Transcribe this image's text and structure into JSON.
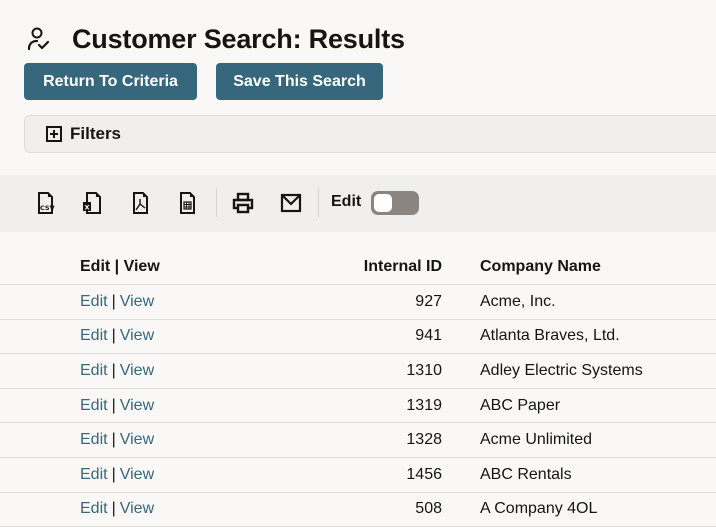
{
  "page": {
    "title": "Customer Search: Results",
    "title_icon": "person-check-icon"
  },
  "buttons": {
    "return_label": "Return To Criteria",
    "save_label": "Save This Search"
  },
  "filters": {
    "label": "Filters",
    "icon": "plus-box-icon",
    "expanded": false
  },
  "toolbar": {
    "icons": [
      "export-csv-icon",
      "export-excel-icon",
      "export-pdf-icon",
      "export-table-icon",
      "print-icon",
      "email-icon"
    ],
    "edit_label": "Edit",
    "edit_toggle_on": false
  },
  "table": {
    "columns": {
      "edit_view": "Edit | View",
      "internal_id": "Internal ID",
      "company_name": "Company Name"
    },
    "link_edit": "Edit",
    "link_sep": "|",
    "link_view": "View",
    "rows": [
      {
        "id": "927",
        "name": "Acme, Inc."
      },
      {
        "id": "941",
        "name": "Atlanta Braves, Ltd."
      },
      {
        "id": "1310",
        "name": "Adley Electric Systems"
      },
      {
        "id": "1319",
        "name": "ABC Paper"
      },
      {
        "id": "1328",
        "name": "Acme Unlimited"
      },
      {
        "id": "1456",
        "name": "ABC Rentals"
      },
      {
        "id": "508",
        "name": "A Company 4OL"
      }
    ]
  },
  "colors": {
    "accent": "#36677d",
    "background": "#f9f8f6",
    "toolbar_bg": "#f0efed",
    "toggle_off": "#8b8580"
  }
}
